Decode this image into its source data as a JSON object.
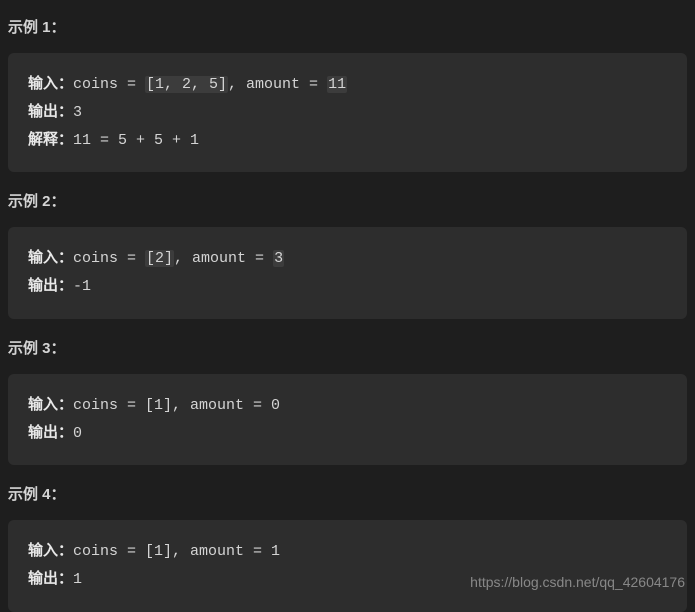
{
  "examples": [
    {
      "title": "示例 1：",
      "lines": [
        {
          "label": "输入：",
          "prefix": "coins = ",
          "hl1": "[1, 2, 5]",
          "mid": ", amount = ",
          "hl2": "11"
        },
        {
          "label": "输出：",
          "text": "3"
        },
        {
          "label": "解释：",
          "text": "11 = 5 + 5 + 1"
        }
      ]
    },
    {
      "title": "示例 2：",
      "lines": [
        {
          "label": "输入：",
          "prefix": "coins = ",
          "hl1": "[2]",
          "mid": ", amount = ",
          "hl2": "3"
        },
        {
          "label": "输出：",
          "text": "-1"
        }
      ]
    },
    {
      "title": "示例 3：",
      "lines": [
        {
          "label": "输入：",
          "text": "coins = [1], amount = 0"
        },
        {
          "label": "输出：",
          "text": "0"
        }
      ]
    },
    {
      "title": "示例 4：",
      "lines": [
        {
          "label": "输入：",
          "text": "coins = [1], amount = 1"
        },
        {
          "label": "输出：",
          "text": "1"
        }
      ]
    }
  ],
  "watermark": "https://blog.csdn.net/qq_42604176"
}
